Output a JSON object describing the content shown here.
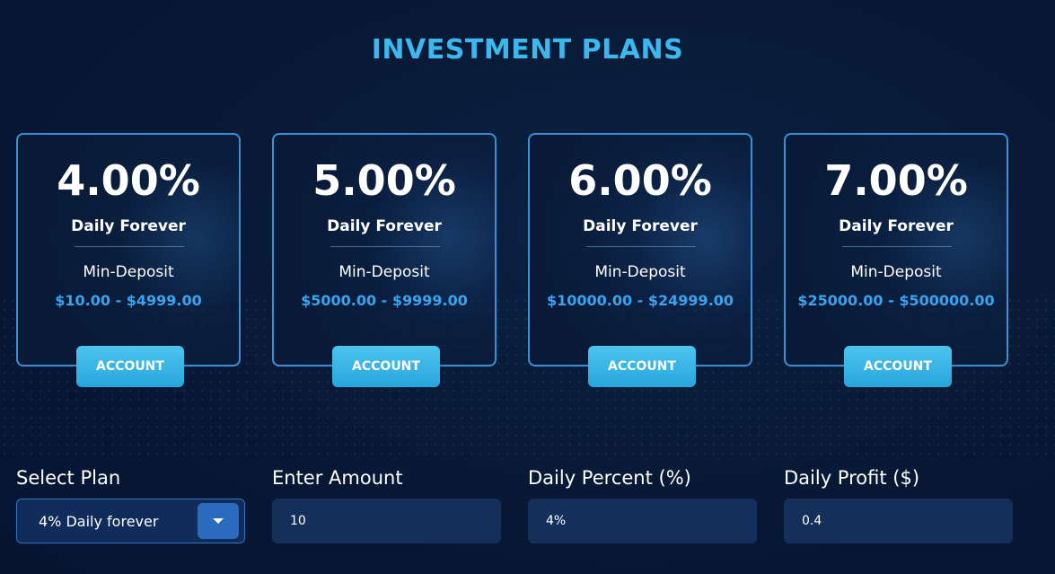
{
  "title": "INVESTMENT PLANS",
  "plans": [
    {
      "percent": "4.00%",
      "frequency": "Daily Forever",
      "min_label": "Min-Deposit",
      "range": "$10.00 - $4999.00",
      "button": "ACCOUNT"
    },
    {
      "percent": "5.00%",
      "frequency": "Daily Forever",
      "min_label": "Min-Deposit",
      "range": "$5000.00 - $9999.00",
      "button": "ACCOUNT"
    },
    {
      "percent": "6.00%",
      "frequency": "Daily Forever",
      "min_label": "Min-Deposit",
      "range": "$10000.00 - $24999.00",
      "button": "ACCOUNT"
    },
    {
      "percent": "7.00%",
      "frequency": "Daily Forever",
      "min_label": "Min-Deposit",
      "range": "$25000.00 - $500000.00",
      "button": "ACCOUNT"
    }
  ],
  "calculator": {
    "select_plan": {
      "label": "Select Plan",
      "value": "4% Daily forever",
      "icon": "chevron-down-icon"
    },
    "amount": {
      "label": "Enter Amount",
      "value": "10"
    },
    "percent": {
      "label": "Daily Percent (%)",
      "value": "4%"
    },
    "profit": {
      "label": "Daily Profit ($)",
      "value": "0.4"
    }
  },
  "colors": {
    "accent": "#3cb8ef",
    "range": "#3aa3ee",
    "card_border": "#3a8fd9",
    "button": "#2fb0e3",
    "field": "#142f5a",
    "background": "#081a36"
  }
}
